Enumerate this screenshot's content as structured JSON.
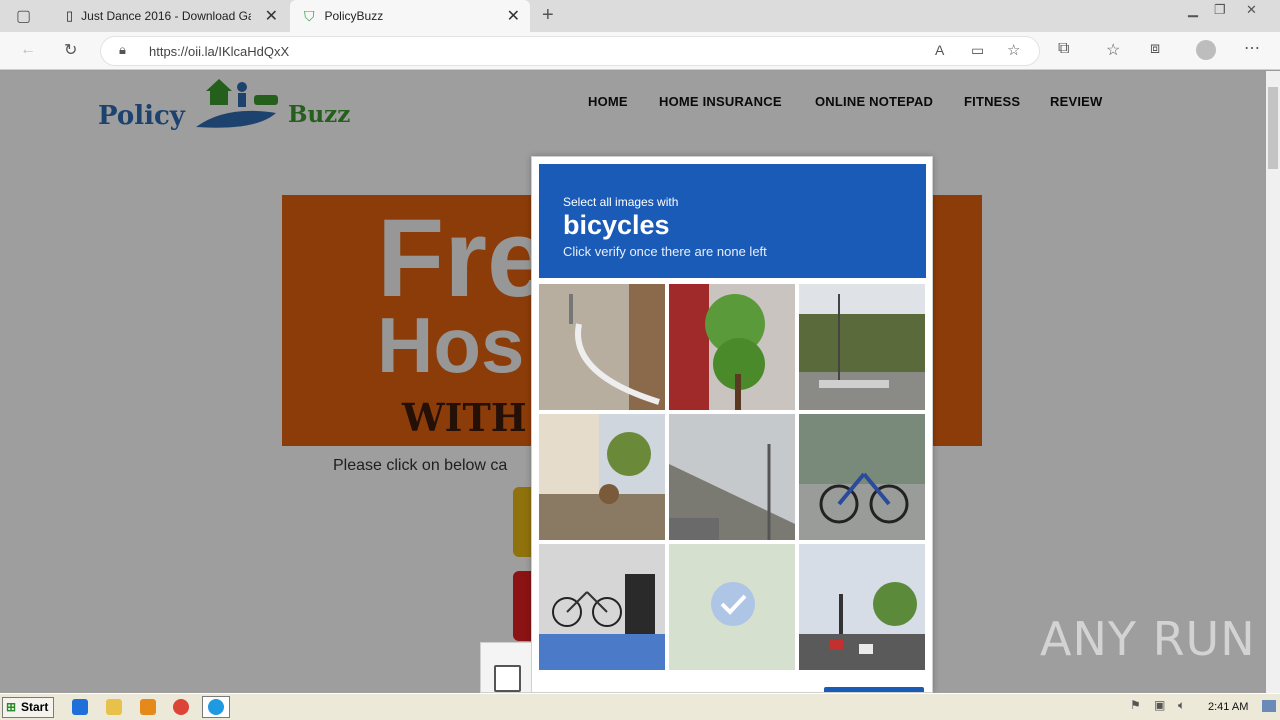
{
  "browser": {
    "tabs": [
      {
        "title": "Just Dance 2016 - Download Ga",
        "active": false
      },
      {
        "title": "PolicyBuzz",
        "active": true
      }
    ],
    "url": "https://oii.la/IKlcaHdQxX"
  },
  "site": {
    "logo": {
      "part1": "Policy",
      "part2": "Buzz"
    },
    "nav": [
      "HOME",
      "HOME INSURANCE",
      "ONLINE NOTEPAD",
      "FITNESS",
      "REVIEW"
    ],
    "banner": {
      "line1": "Fre",
      "line2": "Hos",
      "line3": "WITH C"
    },
    "click_text": "Please click on below ca"
  },
  "captcha": {
    "prompt_pre": "Select all images with",
    "prompt_target": "bicycles",
    "prompt_post": "Click verify once there are none left",
    "tiles": [
      {
        "desc": "street-corner",
        "selected": false
      },
      {
        "desc": "tree-storefront",
        "selected": false
      },
      {
        "desc": "harbor-boats",
        "selected": false
      },
      {
        "desc": "sidewalk-plaza",
        "selected": false
      },
      {
        "desc": "overpass-streetlight",
        "selected": false
      },
      {
        "desc": "parked-bicycles",
        "selected": false
      },
      {
        "desc": "bicycle-wall",
        "selected": false
      },
      {
        "desc": "bicycle-faded",
        "selected": true
      },
      {
        "desc": "traffic-intersection",
        "selected": false
      }
    ]
  },
  "watermark": "ANY RUN",
  "taskbar": {
    "start_label": "Start",
    "clock": "2:41 AM"
  },
  "colors": {
    "captcha_blue": "#1a5bb8",
    "banner_orange": "#e2620d",
    "logo_blue": "#2f6bb0",
    "logo_green": "#3a9a2e"
  }
}
